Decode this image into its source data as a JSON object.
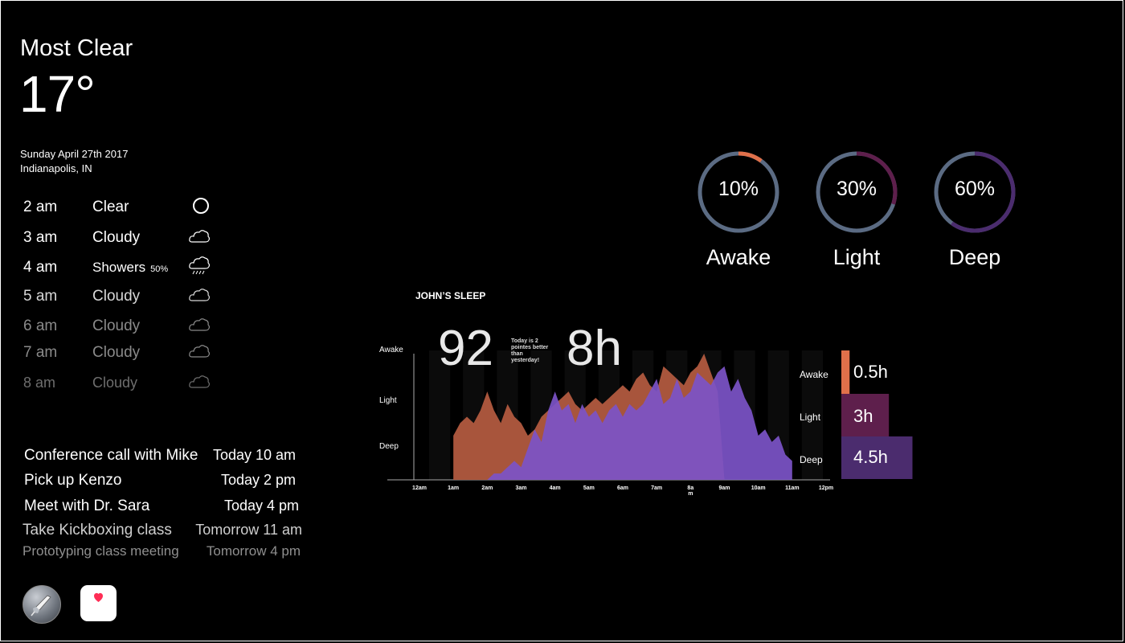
{
  "weather": {
    "condition": "Most Clear",
    "temperature": "17°",
    "date": "Sunday April 27th 2017",
    "location": "Indianapolis, IN",
    "forecast": [
      {
        "time": "2 am",
        "condition": "Clear",
        "icon": "clear-icon"
      },
      {
        "time": "3  am",
        "condition": "Cloudy",
        "icon": "cloudy-icon"
      },
      {
        "time": "4 am",
        "condition": "Showers",
        "precip": "50%",
        "icon": "showers-icon"
      },
      {
        "time": "5 am",
        "condition": "Cloudy",
        "icon": "cloudy-icon"
      },
      {
        "time": "6 am",
        "condition": "Cloudy",
        "icon": "cloudy-icon"
      },
      {
        "time": "7 am",
        "condition": "Cloudy",
        "icon": "cloudy-icon"
      },
      {
        "time": "8 am",
        "condition": "Cloudy",
        "icon": "cloudy-icon"
      }
    ]
  },
  "reminders": [
    {
      "title": "Conference call with Mike",
      "time": "Today 10 am"
    },
    {
      "title": "Pick up Kenzo",
      "time": "Today  2 pm"
    },
    {
      "title": "Meet with Dr. Sara",
      "time": "Today  4 pm"
    },
    {
      "title": "Take Kickboxing class",
      "time": "Tomorrow 11 am"
    },
    {
      "title": "Prototyping class meeting",
      "time": "Tomorrow 4 pm"
    }
  ],
  "apps": [
    {
      "name": "rocket-app",
      "icon": "rocket-icon"
    },
    {
      "name": "health-app",
      "icon": "heart-icon"
    }
  ],
  "sleep_summary": [
    {
      "value": "10%",
      "label": "Awake",
      "fraction": 0.1,
      "color": "#e0704a"
    },
    {
      "value": "30%",
      "label": "Light",
      "fraction": 0.3,
      "color": "#5e1f4c"
    },
    {
      "value": "60%",
      "label": "Deep",
      "fraction": 0.6,
      "color": "#4b2c6e"
    }
  ],
  "colors": {
    "ring_track": "#5b6b83",
    "awake": "#a8553c",
    "deep": "#7c54c8",
    "deep_dark": "#5a48b0"
  },
  "sleep": {
    "title": "JOHN’S SLEEP",
    "score": "92",
    "score_note": "Today is 2 pointes better than yesterday!",
    "total": "8h",
    "y_labels": [
      "Awake",
      "Light",
      "Deep"
    ],
    "x_labels": [
      "12am",
      "1am",
      "2am",
      "3am",
      "4am",
      "5am",
      "6am",
      "7am",
      "8a m",
      "9am",
      "10am",
      "11am",
      "12pm"
    ],
    "breakdown": [
      {
        "label": "Awake",
        "value": "0.5h",
        "hours": 0.5,
        "color": "#e0704a"
      },
      {
        "label": "Light",
        "value": "3h",
        "hours": 3,
        "color": "#5e1f4c"
      },
      {
        "label": "Deep",
        "value": "4.5h",
        "hours": 4.5,
        "color": "#4b2c6e"
      }
    ]
  },
  "chart_data": {
    "type": "area",
    "title": "JOHN’S SLEEP",
    "x_unit": "hour",
    "x": [
      1,
      1.2,
      1.4,
      1.6,
      1.8,
      2,
      2.2,
      2.4,
      2.6,
      2.8,
      3,
      3.2,
      3.4,
      3.6,
      3.8,
      4,
      4.2,
      4.4,
      4.6,
      4.8,
      5,
      5.2,
      5.4,
      5.6,
      5.8,
      6,
      6.2,
      6.4,
      6.6,
      6.8,
      7,
      7.2,
      7.4,
      7.6,
      7.8,
      8,
      8.2,
      8.4,
      8.6,
      8.8,
      9,
      9.2,
      9.4,
      9.6,
      9.8,
      10,
      10.2,
      10.4,
      10.6,
      10.8,
      11
    ],
    "series": [
      {
        "name": "Awake",
        "values": [
          0.35,
          0.45,
          0.5,
          0.45,
          0.55,
          0.7,
          0.55,
          0.45,
          0.6,
          0.5,
          0.45,
          0.35,
          0.4,
          0.5,
          0.55,
          0.6,
          0.65,
          0.7,
          0.6,
          0.55,
          0.6,
          0.65,
          0.6,
          0.65,
          0.7,
          0.75,
          0.7,
          0.8,
          0.85,
          0.75,
          0.7,
          0.9,
          0.85,
          0.8,
          0.75,
          0.85,
          0.9,
          1.0,
          0.85,
          0.7,
          0,
          0,
          0,
          0,
          0,
          0,
          0,
          0,
          0,
          0,
          0
        ]
      },
      {
        "name": "Deep",
        "values": [
          0,
          0,
          0,
          0,
          0,
          0,
          0.05,
          0.05,
          0.1,
          0.15,
          0.1,
          0.25,
          0.4,
          0.3,
          0.55,
          0.7,
          0.55,
          0.6,
          0.45,
          0.6,
          0.5,
          0.55,
          0.45,
          0.55,
          0.6,
          0.5,
          0.6,
          0.55,
          0.6,
          0.7,
          0.8,
          0.6,
          0.65,
          0.8,
          0.65,
          0.7,
          0.85,
          0.8,
          0.75,
          0.85,
          0.9,
          0.7,
          0.8,
          0.65,
          0.55,
          0.35,
          0.4,
          0.3,
          0.35,
          0.2,
          0.15
        ]
      }
    ],
    "ylim": [
      0,
      1
    ],
    "y_labels": [
      "Awake",
      "Light",
      "Deep"
    ]
  }
}
